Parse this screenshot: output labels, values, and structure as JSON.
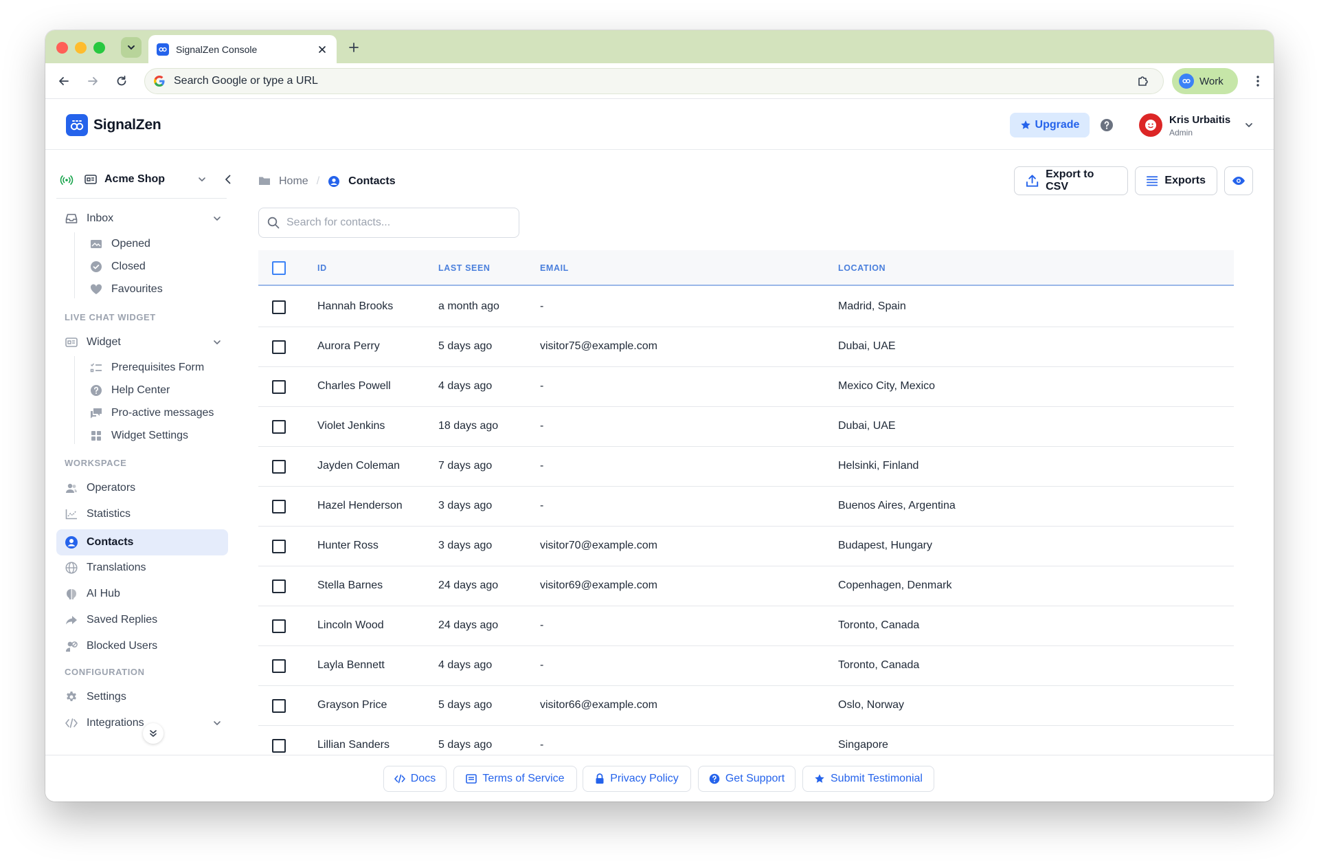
{
  "browser": {
    "tab_title": "SignalZen Console",
    "omnibox_placeholder": "Search Google or type a URL",
    "profile_name": "Work"
  },
  "header": {
    "brand": "SignalZen",
    "upgrade_label": "Upgrade",
    "user_name": "Kris Urbaitis",
    "user_role": "Admin"
  },
  "sidebar": {
    "workspace": "Acme Shop",
    "inbox": {
      "label": "Inbox",
      "children": [
        "Opened",
        "Closed",
        "Favourites"
      ]
    },
    "live_chat_section": "LIVE CHAT WIDGET",
    "widget": {
      "label": "Widget",
      "children": [
        "Prerequisites Form",
        "Help Center",
        "Pro-active messages",
        "Widget Settings"
      ]
    },
    "workspace_section": "WORKSPACE",
    "workspace_items": [
      "Operators",
      "Statistics",
      "Contacts",
      "Translations",
      "AI Hub",
      "Saved Replies",
      "Blocked Users"
    ],
    "active_item": "Contacts",
    "configuration_section": "CONFIGURATION",
    "configuration_items": [
      "Settings",
      "Integrations"
    ]
  },
  "breadcrumb": {
    "home": "Home",
    "separator": "/",
    "current": "Contacts"
  },
  "actions": {
    "export_csv": "Export to CSV",
    "exports": "Exports"
  },
  "search": {
    "placeholder": "Search for contacts..."
  },
  "table": {
    "columns": [
      "ID",
      "LAST SEEN",
      "EMAIL",
      "LOCATION"
    ],
    "rows": [
      {
        "id": "Hannah Brooks",
        "last_seen": "a month ago",
        "email": "-",
        "location": "Madrid, Spain"
      },
      {
        "id": "Aurora Perry",
        "last_seen": "5 days ago",
        "email": "visitor75@example.com",
        "location": "Dubai, UAE"
      },
      {
        "id": "Charles Powell",
        "last_seen": "4 days ago",
        "email": "-",
        "location": "Mexico City, Mexico"
      },
      {
        "id": "Violet Jenkins",
        "last_seen": "18 days ago",
        "email": "-",
        "location": "Dubai, UAE"
      },
      {
        "id": "Jayden Coleman",
        "last_seen": "7 days ago",
        "email": "-",
        "location": "Helsinki, Finland"
      },
      {
        "id": "Hazel Henderson",
        "last_seen": "3 days ago",
        "email": "-",
        "location": "Buenos Aires, Argentina"
      },
      {
        "id": "Hunter Ross",
        "last_seen": "3 days ago",
        "email": "visitor70@example.com",
        "location": "Budapest, Hungary"
      },
      {
        "id": "Stella Barnes",
        "last_seen": "24 days ago",
        "email": "visitor69@example.com",
        "location": "Copenhagen, Denmark"
      },
      {
        "id": "Lincoln Wood",
        "last_seen": "24 days ago",
        "email": "-",
        "location": "Toronto, Canada"
      },
      {
        "id": "Layla Bennett",
        "last_seen": "4 days ago",
        "email": "-",
        "location": "Toronto, Canada"
      },
      {
        "id": "Grayson Price",
        "last_seen": "5 days ago",
        "email": "visitor66@example.com",
        "location": "Oslo, Norway"
      },
      {
        "id": "Lillian Sanders",
        "last_seen": "5 days ago",
        "email": "-",
        "location": "Singapore"
      }
    ]
  },
  "footer": {
    "links": [
      "Docs",
      "Terms of Service",
      "Privacy Policy",
      "Get Support",
      "Submit Testimonial"
    ]
  },
  "colors": {
    "accent": "#2563eb",
    "tabstrip": "#d3e3bd",
    "active_nav_bg": "#e5ecfb",
    "table_header_text": "#4a7fdc"
  },
  "icons": {
    "upgrade": "star-icon",
    "help": "question-circle-icon",
    "export_csv": "upload-icon",
    "exports": "list-icon",
    "view": "eye-icon",
    "footer": [
      "code-icon",
      "document-icon",
      "lock-icon",
      "question-circle-icon",
      "star-icon"
    ]
  }
}
